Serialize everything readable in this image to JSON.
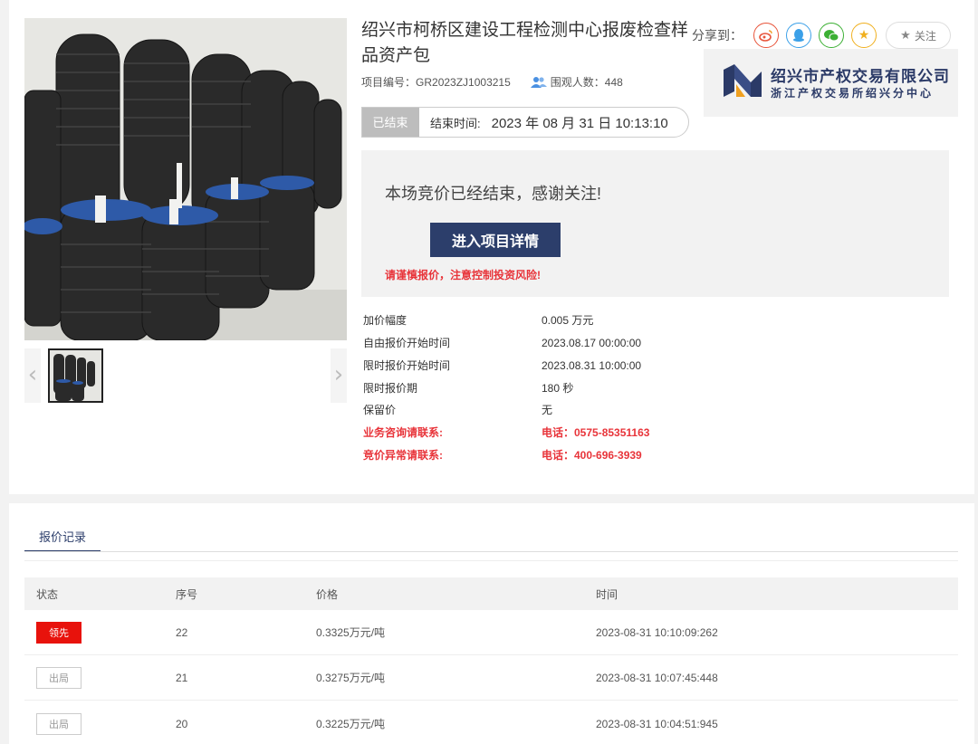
{
  "title": "绍兴市柯桥区建设工程检测中心报废检查样品资产包",
  "meta": {
    "project_no_label": "项目编号：",
    "project_no": "GR2023ZJ1003215",
    "viewers_label": "围观人数：",
    "viewers": "448"
  },
  "share": {
    "label": "分享到：",
    "follow_label": "关注",
    "icons": [
      "weibo-icon",
      "qq-icon",
      "wechat-icon",
      "qzone-icon"
    ]
  },
  "logo": {
    "line1": "绍兴市产权交易有限公司",
    "line2": "浙江产权交易所绍兴分中心"
  },
  "status": {
    "tag": "已结束",
    "end_label": "结束时间:",
    "end_time": "2023 年 08 月 31 日 10:13:10"
  },
  "end_box": {
    "message": "本场竞价已经结束，感谢关注!",
    "detail_button": "进入项目详情",
    "warning": "请谨慎报价，注意控制投资风险!"
  },
  "info": [
    {
      "k": "加价幅度",
      "v": "0.005 万元"
    },
    {
      "k": "自由报价开始时间",
      "v": "2023.08.17 00:00:00"
    },
    {
      "k": "限时报价开始时间",
      "v": "2023.08.31 10:00:00"
    },
    {
      "k": "限时报价期",
      "v": "180 秒"
    },
    {
      "k": "保留价",
      "v": "无"
    },
    {
      "k": "业务咨询请联系:",
      "v": "电话：0575-85351163"
    },
    {
      "k": "竞价异常请联系:",
      "v": "电话：400-696-3939"
    }
  ],
  "tab": "报价记录",
  "table": {
    "headers": [
      "状态",
      "序号",
      "价格",
      "时间"
    ],
    "rows": [
      {
        "status": "领先",
        "no": "22",
        "price": "0.3325万元/吨",
        "time": "2023-08-31 10:10:09:262"
      },
      {
        "status": "出局",
        "no": "21",
        "price": "0.3275万元/吨",
        "time": "2023-08-31 10:07:45:448"
      },
      {
        "status": "出局",
        "no": "20",
        "price": "0.3225万元/吨",
        "time": "2023-08-31 10:04:51:945"
      }
    ]
  },
  "colors": {
    "accent": "#2c3e6b",
    "warn": "#e8343a",
    "lead": "#e8120c"
  }
}
